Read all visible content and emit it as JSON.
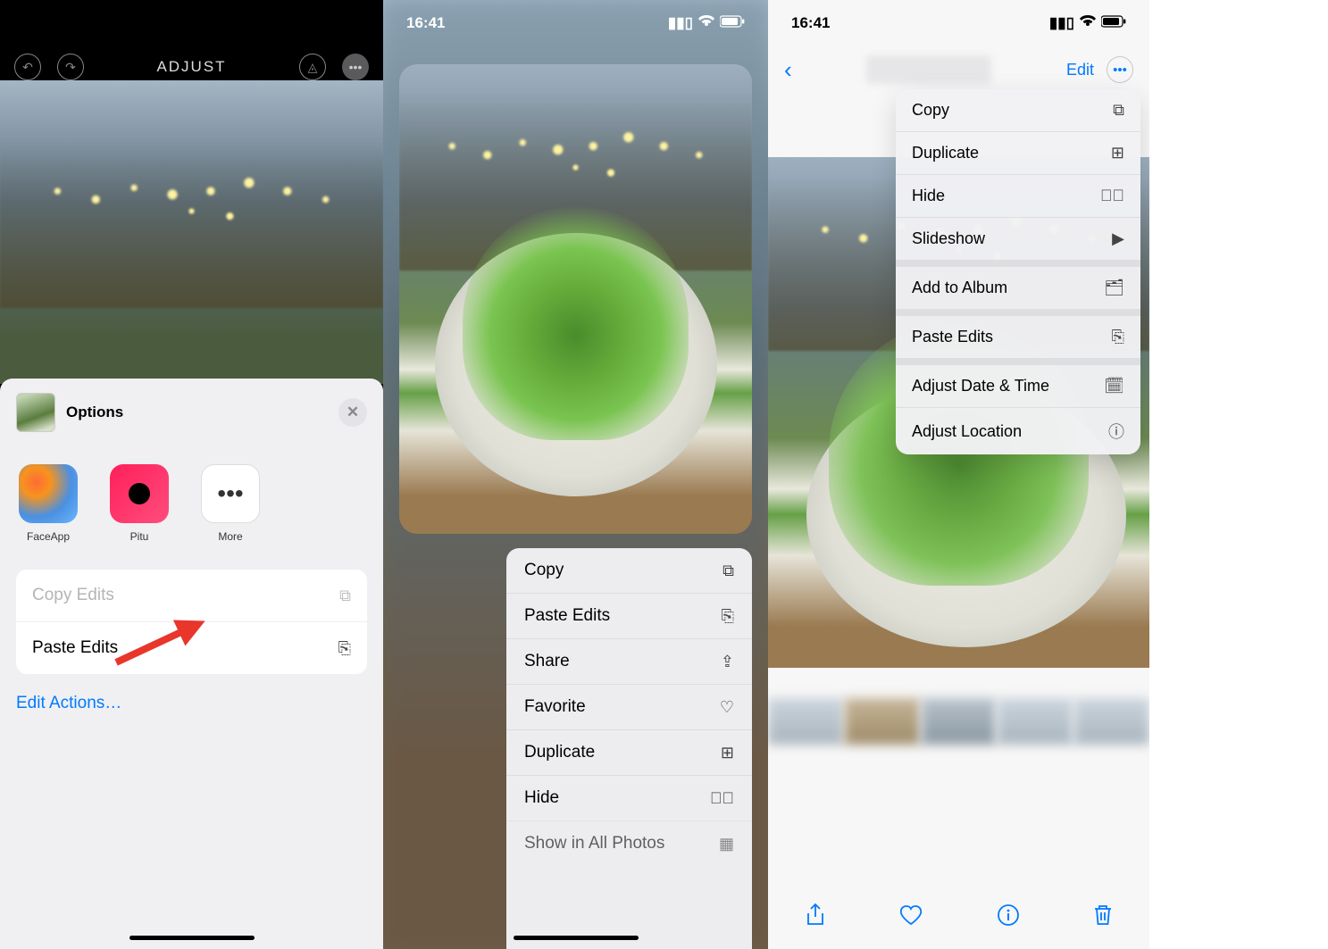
{
  "panel1": {
    "topbar_title": "ADJUST",
    "sheet_title": "Options",
    "apps": [
      {
        "name": "FaceApp"
      },
      {
        "name": "Pitu"
      },
      {
        "name": "More"
      }
    ],
    "list": {
      "copy_edits": "Copy Edits",
      "paste_edits": "Paste Edits"
    },
    "edit_actions": "Edit Actions…"
  },
  "panel2": {
    "time": "16:41",
    "menu": {
      "copy": "Copy",
      "paste_edits": "Paste Edits",
      "share": "Share",
      "favorite": "Favorite",
      "duplicate": "Duplicate",
      "hide": "Hide",
      "show_all": "Show in All Photos"
    }
  },
  "panel3": {
    "time": "16:41",
    "edit_link": "Edit",
    "menu": {
      "copy": "Copy",
      "duplicate": "Duplicate",
      "hide": "Hide",
      "slideshow": "Slideshow",
      "add_to_album": "Add to Album",
      "paste_edits": "Paste Edits",
      "adjust_date": "Adjust Date & Time",
      "adjust_location": "Adjust Location"
    }
  },
  "icons": {
    "signal": "▪▪",
    "wifi": "📶",
    "battery": "🔋"
  }
}
